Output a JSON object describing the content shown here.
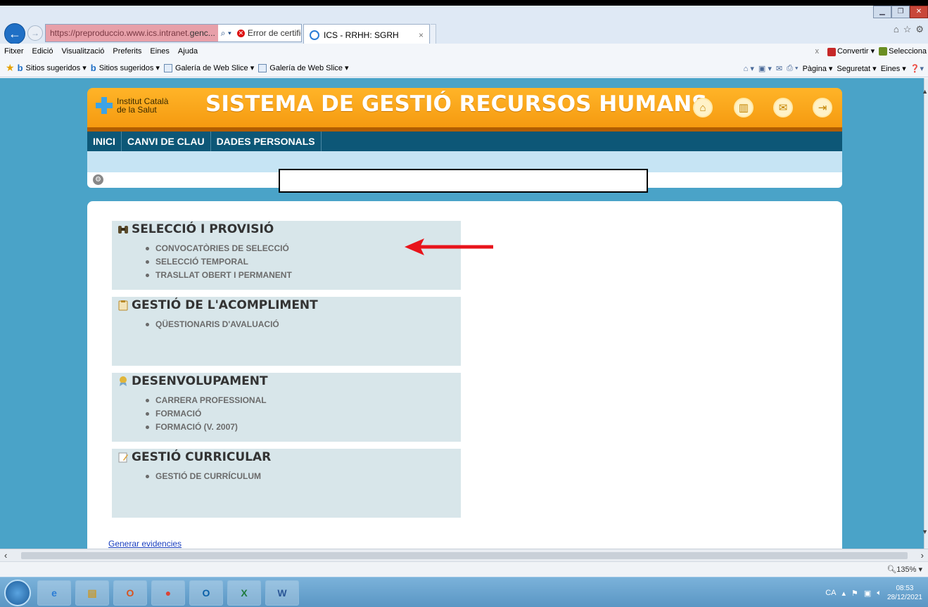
{
  "browser": {
    "address": {
      "url_prefix": "https://preproduccio.www.ics.intranet.",
      "url_domain": "genc...",
      "search_icon": "search-icon",
      "cert_error": "Error de certificat",
      "refresh_icon": "refresh-icon"
    },
    "tab": {
      "title": "ICS - RRHH: SGRH",
      "close": "×"
    },
    "menu": [
      "Fitxer",
      "Edició",
      "Visualització",
      "Preferits",
      "Eines",
      "Ajuda"
    ],
    "menu_right": {
      "close": "x",
      "convert": "Convertir",
      "select": "Selecciona"
    },
    "favorites": [
      {
        "label": "Sitios sugeridos ▾",
        "icon": "bing-icon"
      },
      {
        "label": "Sitios sugeridos ▾",
        "icon": "bing-icon"
      },
      {
        "label": "Galería de Web Slice ▾",
        "icon": "web-slice-icon"
      },
      {
        "label": "Galería de Web Slice ▾",
        "icon": "web-slice-icon"
      }
    ],
    "commands": {
      "page": "Pàgina ▾",
      "safety": "Seguretat ▾",
      "tools": "Eines ▾"
    }
  },
  "app": {
    "logo_line1": "Institut Català",
    "logo_line2": "de la Salut",
    "title": "SISTEMA DE GESTIÓ RECURSOS HUMANS",
    "nav": [
      "INICI",
      "CANVI DE CLAU",
      "DADES PERSONALS"
    ],
    "header_icons": [
      "home-icon",
      "book-icon",
      "mail-icon",
      "logout-icon"
    ],
    "sections": [
      {
        "title": "SELECCIÓ I PROVISIÓ",
        "icon": "binoculars-icon",
        "items": [
          "CONVOCATÒRIES DE SELECCIÓ",
          "SELECCIÓ TEMPORAL",
          "TRASLLAT OBERT I PERMANENT"
        ]
      },
      {
        "title": "GESTIÓ DE L'ACOMPLIMENT",
        "icon": "clipboard-icon",
        "items": [
          "QÜESTIONARIS D'AVALUACIÓ"
        ]
      },
      {
        "title": "DESENVOLUPAMENT",
        "icon": "award-icon",
        "items": [
          "CARRERA PROFESSIONAL",
          "FORMACIÓ",
          "FORMACIÓ (V. 2007)"
        ]
      },
      {
        "title": "GESTIÓ CURRICULAR",
        "icon": "edit-document-icon",
        "items": [
          "GESTIÓ DE CURRÍCULUM"
        ]
      }
    ],
    "footer_link": "Generar evidencies",
    "annotation_color": "#e8141b"
  },
  "statusbar": {
    "zoom": "135%"
  },
  "taskbar": {
    "apps": [
      "internet-explorer-icon",
      "file-explorer-icon",
      "office-icon",
      "chrome-icon",
      "outlook-icon",
      "excel-icon",
      "word-icon"
    ],
    "lang": "CA",
    "time": "08:53",
    "date": "28/12/2021"
  }
}
